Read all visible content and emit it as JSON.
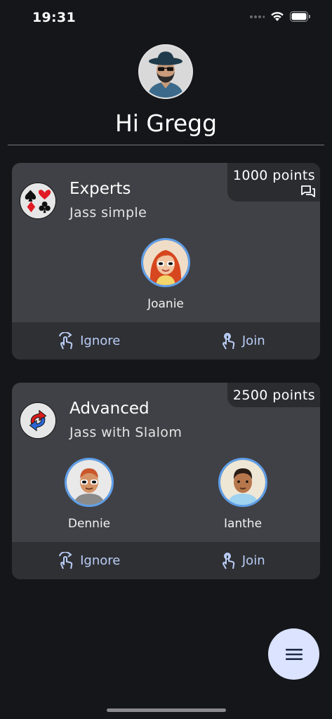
{
  "status_bar": {
    "time": "19:31"
  },
  "header": {
    "greeting": "Hi Gregg"
  },
  "cards": [
    {
      "points": "1000 points",
      "title": "Experts",
      "subtitle": "Jass simple",
      "players": [
        {
          "name": "Joanie"
        }
      ],
      "actions": {
        "ignore": "Ignore",
        "join": "Join"
      }
    },
    {
      "points": "2500 points",
      "title": "Advanced",
      "subtitle": "Jass with Slalom",
      "players": [
        {
          "name": "Dennie"
        },
        {
          "name": "Ianthe"
        }
      ],
      "actions": {
        "ignore": "Ignore",
        "join": "Join"
      }
    }
  ],
  "icons": [
    "wifi-icon",
    "battery-icon",
    "chat-icon",
    "card-suits-icon",
    "slalom-arrows-icon",
    "ignore-gesture-icon",
    "join-hand-icon",
    "menu-icon"
  ],
  "colors": {
    "background": "#15161a",
    "card": "#404146",
    "accent": "#b9cdf6",
    "avatar_border": "#5f9fe9",
    "fab": "#dbe3ff"
  }
}
